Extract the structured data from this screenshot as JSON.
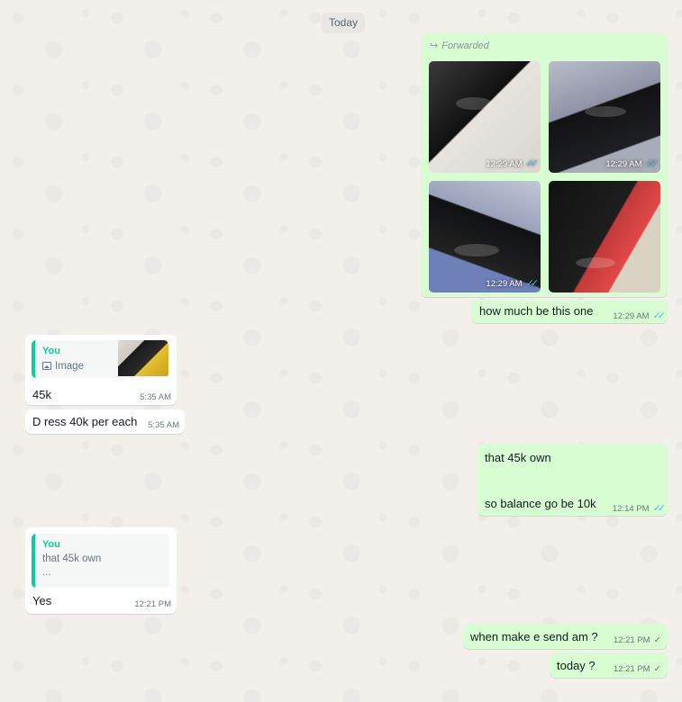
{
  "date_divider": "Today",
  "album": {
    "forwarded_label": "Forwarded",
    "images": [
      {
        "name": "shoe-photo-1",
        "time": "12:29 AM"
      },
      {
        "name": "shoe-photo-2",
        "time": "12:29 AM"
      },
      {
        "name": "shoe-photo-3",
        "time": "12:29 AM"
      },
      {
        "name": "shoe-photo-4",
        "time": ""
      }
    ]
  },
  "messages": [
    {
      "id": "m1",
      "direction": "out",
      "text": "how much be this one",
      "time": "12:29 AM",
      "status": "read"
    },
    {
      "id": "m2",
      "direction": "in",
      "quote_author": "You",
      "quote_text": "Image",
      "text": "45k",
      "time": "5:35 AM"
    },
    {
      "id": "m3",
      "direction": "in",
      "text": "D ress 40k per each",
      "time": "5:35 AM"
    },
    {
      "id": "m4",
      "direction": "out",
      "line1": "that 45k own",
      "line2": "so balance go be 10k",
      "time": "12:14 PM",
      "status": "read"
    },
    {
      "id": "m5",
      "direction": "in",
      "quote_author": "You",
      "quote_line1": "that 45k own",
      "quote_line2": "...",
      "text": "Yes",
      "time": "12:21 PM"
    },
    {
      "id": "m6",
      "direction": "out",
      "text": "when make e send am ?",
      "time": "12:21 PM",
      "status": "sent"
    },
    {
      "id": "m7",
      "direction": "out",
      "text": "today ?",
      "time": "12:21 PM",
      "status": "sent"
    }
  ],
  "icons": {
    "forward": "forward-arrow-icon",
    "image": "image-icon",
    "read_ticks": "double-check-icon",
    "sent_tick": "single-check-icon"
  },
  "colors": {
    "outgoing_bubble": "#d9fdd3",
    "incoming_bubble": "#ffffff",
    "read_tick": "#53bdeb",
    "quote_accent": "#06cf9c"
  }
}
